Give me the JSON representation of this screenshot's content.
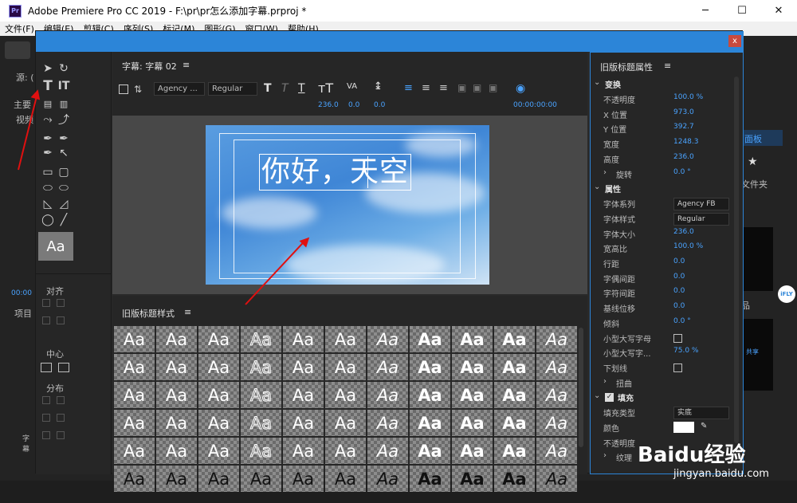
{
  "window": {
    "app_icon": "Pr",
    "title": "Adobe Premiere Pro CC 2019 - F:\\pr\\pr怎么添加字幕.prproj *",
    "min_icon": "─",
    "max_icon": "☐",
    "close_icon": "✕"
  },
  "menubar": {
    "items": [
      "文件(F)",
      "编辑(E)",
      "剪辑(C)",
      "序列(S)",
      "标记(M)",
      "图形(G)",
      "窗口(W)",
      "帮助(H)"
    ]
  },
  "background": {
    "left_labels": [
      "源: (",
      "主要",
      "视频",
      "项目"
    ],
    "timecode": "00:00",
    "right_panel_label": "面板",
    "right_label2": "文件夹",
    "iflytek": "iFLY",
    "bottom_text": "字幕",
    "share": "共享",
    "pin": "品"
  },
  "dialog": {
    "close_label": "x",
    "title_panel": {
      "title": "字幕: 字幕 02",
      "menu_icon": "≡",
      "font_family": "Agency ...",
      "font_style": "Regular",
      "font_size": "236.0",
      "kerning": "0.0",
      "leading": "0.0",
      "timecode": "00:00:00:00"
    },
    "caption_text": "你好，天空",
    "tools": {
      "align_label": "对齐",
      "center_label": "中心",
      "distribute_label": "分布",
      "style_preview": "Aa"
    },
    "style_panel": {
      "title": "旧版标题样式",
      "menu_icon": "≡",
      "swatch_text": "Aa"
    },
    "props": {
      "title": "旧版标题属性",
      "menu_icon": "≡",
      "sections": {
        "transform": "变换",
        "properties": "属性",
        "fill": "填充",
        "rotation": "旋转",
        "distort": "扭曲"
      },
      "rows": [
        {
          "label": "不透明度",
          "value": "100.0 %"
        },
        {
          "label": "X 位置",
          "value": "973.0"
        },
        {
          "label": "Y 位置",
          "value": "392.7"
        },
        {
          "label": "宽度",
          "value": "1248.3"
        },
        {
          "label": "高度",
          "value": "236.0"
        }
      ],
      "rotation_value": "0.0 °",
      "font_family_label": "字体系列",
      "font_family_value": "Agency FB",
      "font_style_label": "字体样式",
      "font_style_value": "Regular",
      "prop_rows": [
        {
          "label": "字体大小",
          "value": "236.0"
        },
        {
          "label": "宽高比",
          "value": "100.0 %"
        },
        {
          "label": "行距",
          "value": "0.0"
        },
        {
          "label": "字偶间距",
          "value": "0.0"
        },
        {
          "label": "字符间距",
          "value": "0.0"
        },
        {
          "label": "基线位移",
          "value": "0.0"
        },
        {
          "label": "倾斜",
          "value": "0.0 °"
        }
      ],
      "smallcaps_label": "小型大写字母",
      "smallcaps_size_label": "小型大写字...",
      "smallcaps_size_value": "75.0 %",
      "underline_label": "下划线",
      "fill_type_label": "填充类型",
      "fill_type_value": "实底",
      "color_label": "颜色",
      "opacity_label2": "不透明度",
      "texture_label": "纹理"
    }
  },
  "watermark": {
    "brand": "Baidu经验",
    "url": "jingyan.baidu.com"
  },
  "colors": {
    "accent": "#2c85d8",
    "value_blue": "#4aa3ff",
    "arrow_red": "#e01010",
    "close_red": "#c74a3d"
  }
}
